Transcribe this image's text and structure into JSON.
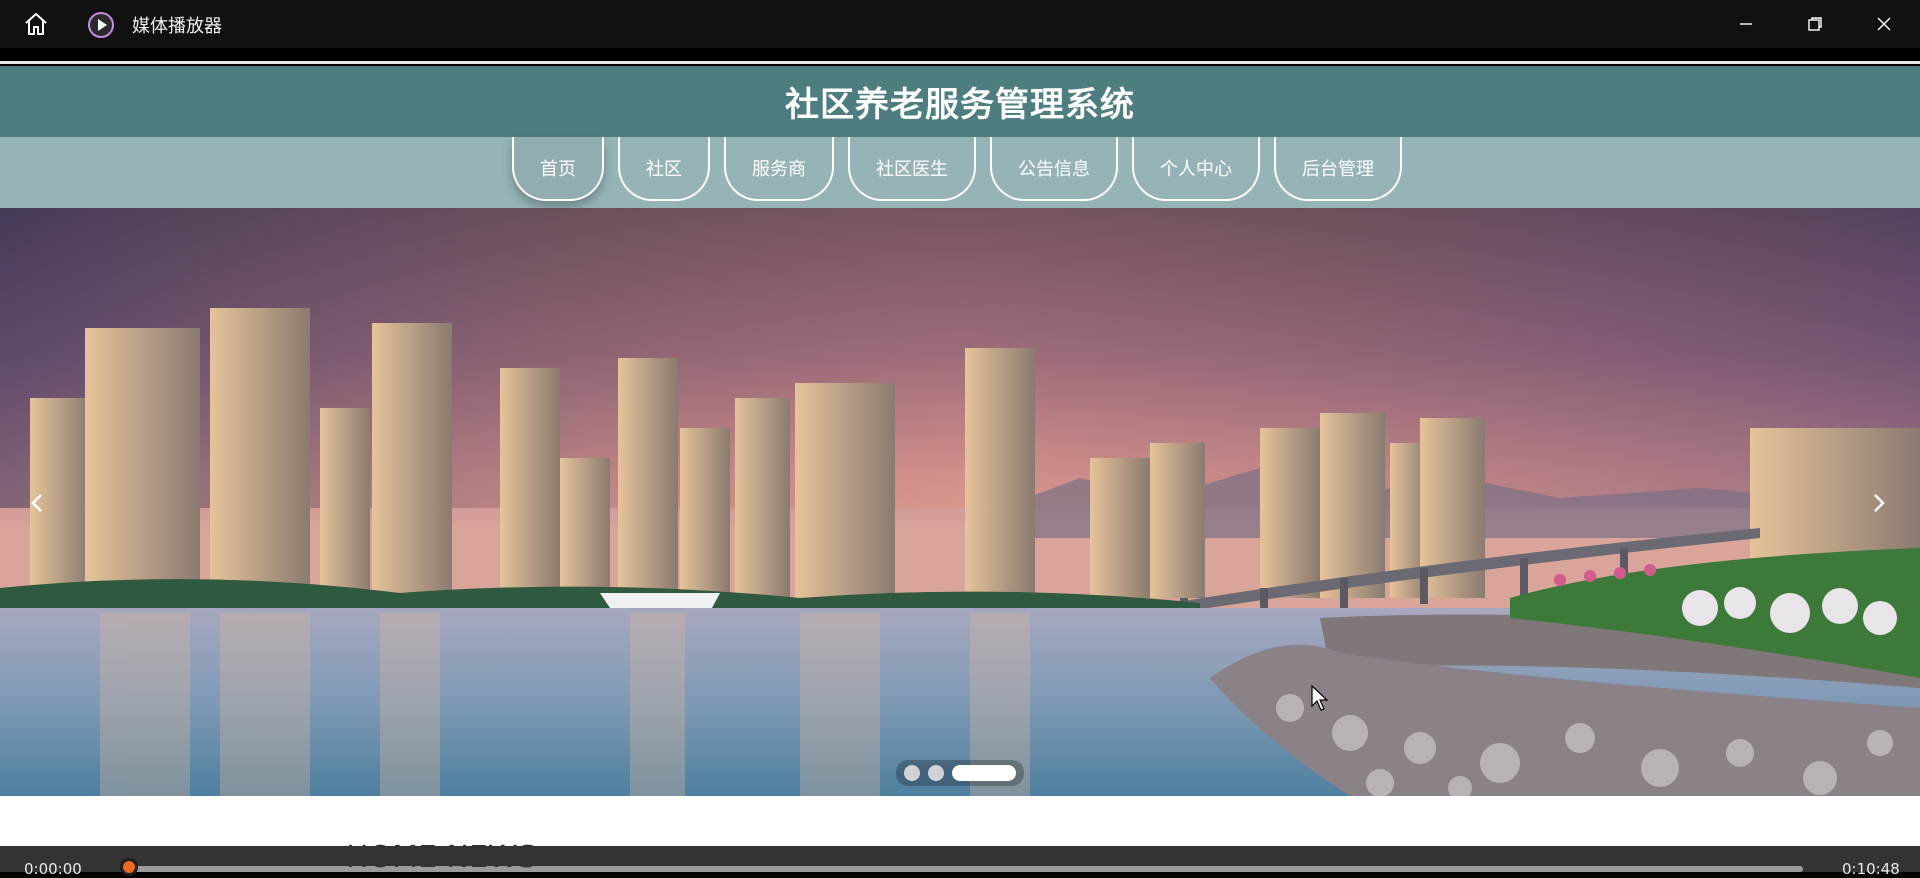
{
  "window": {
    "app_title": "媒体播放器"
  },
  "site": {
    "title": "社区养老服务管理系统",
    "nav": [
      {
        "label": "首页",
        "active": true
      },
      {
        "label": "社区",
        "active": false
      },
      {
        "label": "服务商",
        "active": false
      },
      {
        "label": "社区医生",
        "active": false
      },
      {
        "label": "公告信息",
        "active": false
      },
      {
        "label": "个人中心",
        "active": false
      },
      {
        "label": "后台管理",
        "active": false
      }
    ],
    "carousel": {
      "slide_count": 3,
      "active_slide": 3
    },
    "section_heading": "HOME NEWS"
  },
  "player": {
    "current_time": "0:00:00",
    "total_time": "0:10:48",
    "progress": 0.0
  },
  "colors": {
    "header_bg": "#4e7d80",
    "nav_bg": "#96b4b6",
    "progress_thumb": "#f06a1d"
  }
}
